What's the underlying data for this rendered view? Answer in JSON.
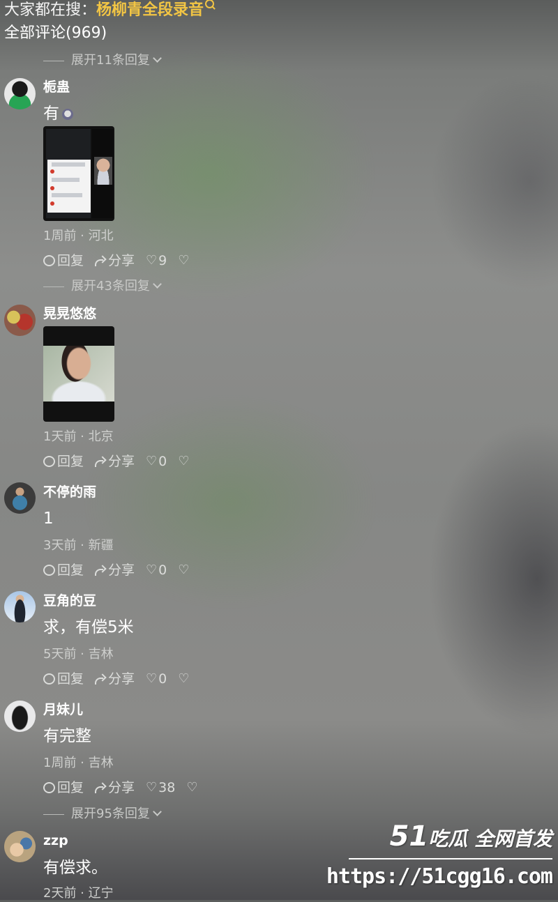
{
  "search_bar": {
    "prefix": "大家都在搜：",
    "query": "杨柳青全段录音"
  },
  "comments_header": {
    "title": "全部评论(969)"
  },
  "expand_replies": [
    "展开11条回复",
    "展开43条回复",
    "展开95条回复"
  ],
  "action_labels": {
    "reply": "回复",
    "share": "分享"
  },
  "comments": [
    {
      "username": "栀蛊",
      "text": "有",
      "meta": "1周前 · 河北",
      "likes": "9"
    },
    {
      "username": "晃晃悠悠",
      "text": "",
      "meta": "1天前 · 北京",
      "likes": "0"
    },
    {
      "username": "不停的雨",
      "text": "1",
      "meta": "3天前 · 新疆",
      "likes": "0"
    },
    {
      "username": "豆角的豆",
      "text": "求，有偿5米",
      "meta": "5天前 · 吉林",
      "likes": "0"
    },
    {
      "username": "月妹儿",
      "text": "有完整",
      "meta": "1周前 · 吉林",
      "likes": "38"
    },
    {
      "username": "zzp",
      "text": "有偿求。",
      "meta": "2天前 · 辽宁"
    }
  ],
  "watermark": {
    "brand_num": "51",
    "brand_text": "吃瓜 全网首发",
    "url": "https://51cgg16.com"
  },
  "colors": {
    "search_highlight": "#f2c544",
    "text_primary": "#ffffff",
    "text_secondary": "#cfd0ce"
  }
}
